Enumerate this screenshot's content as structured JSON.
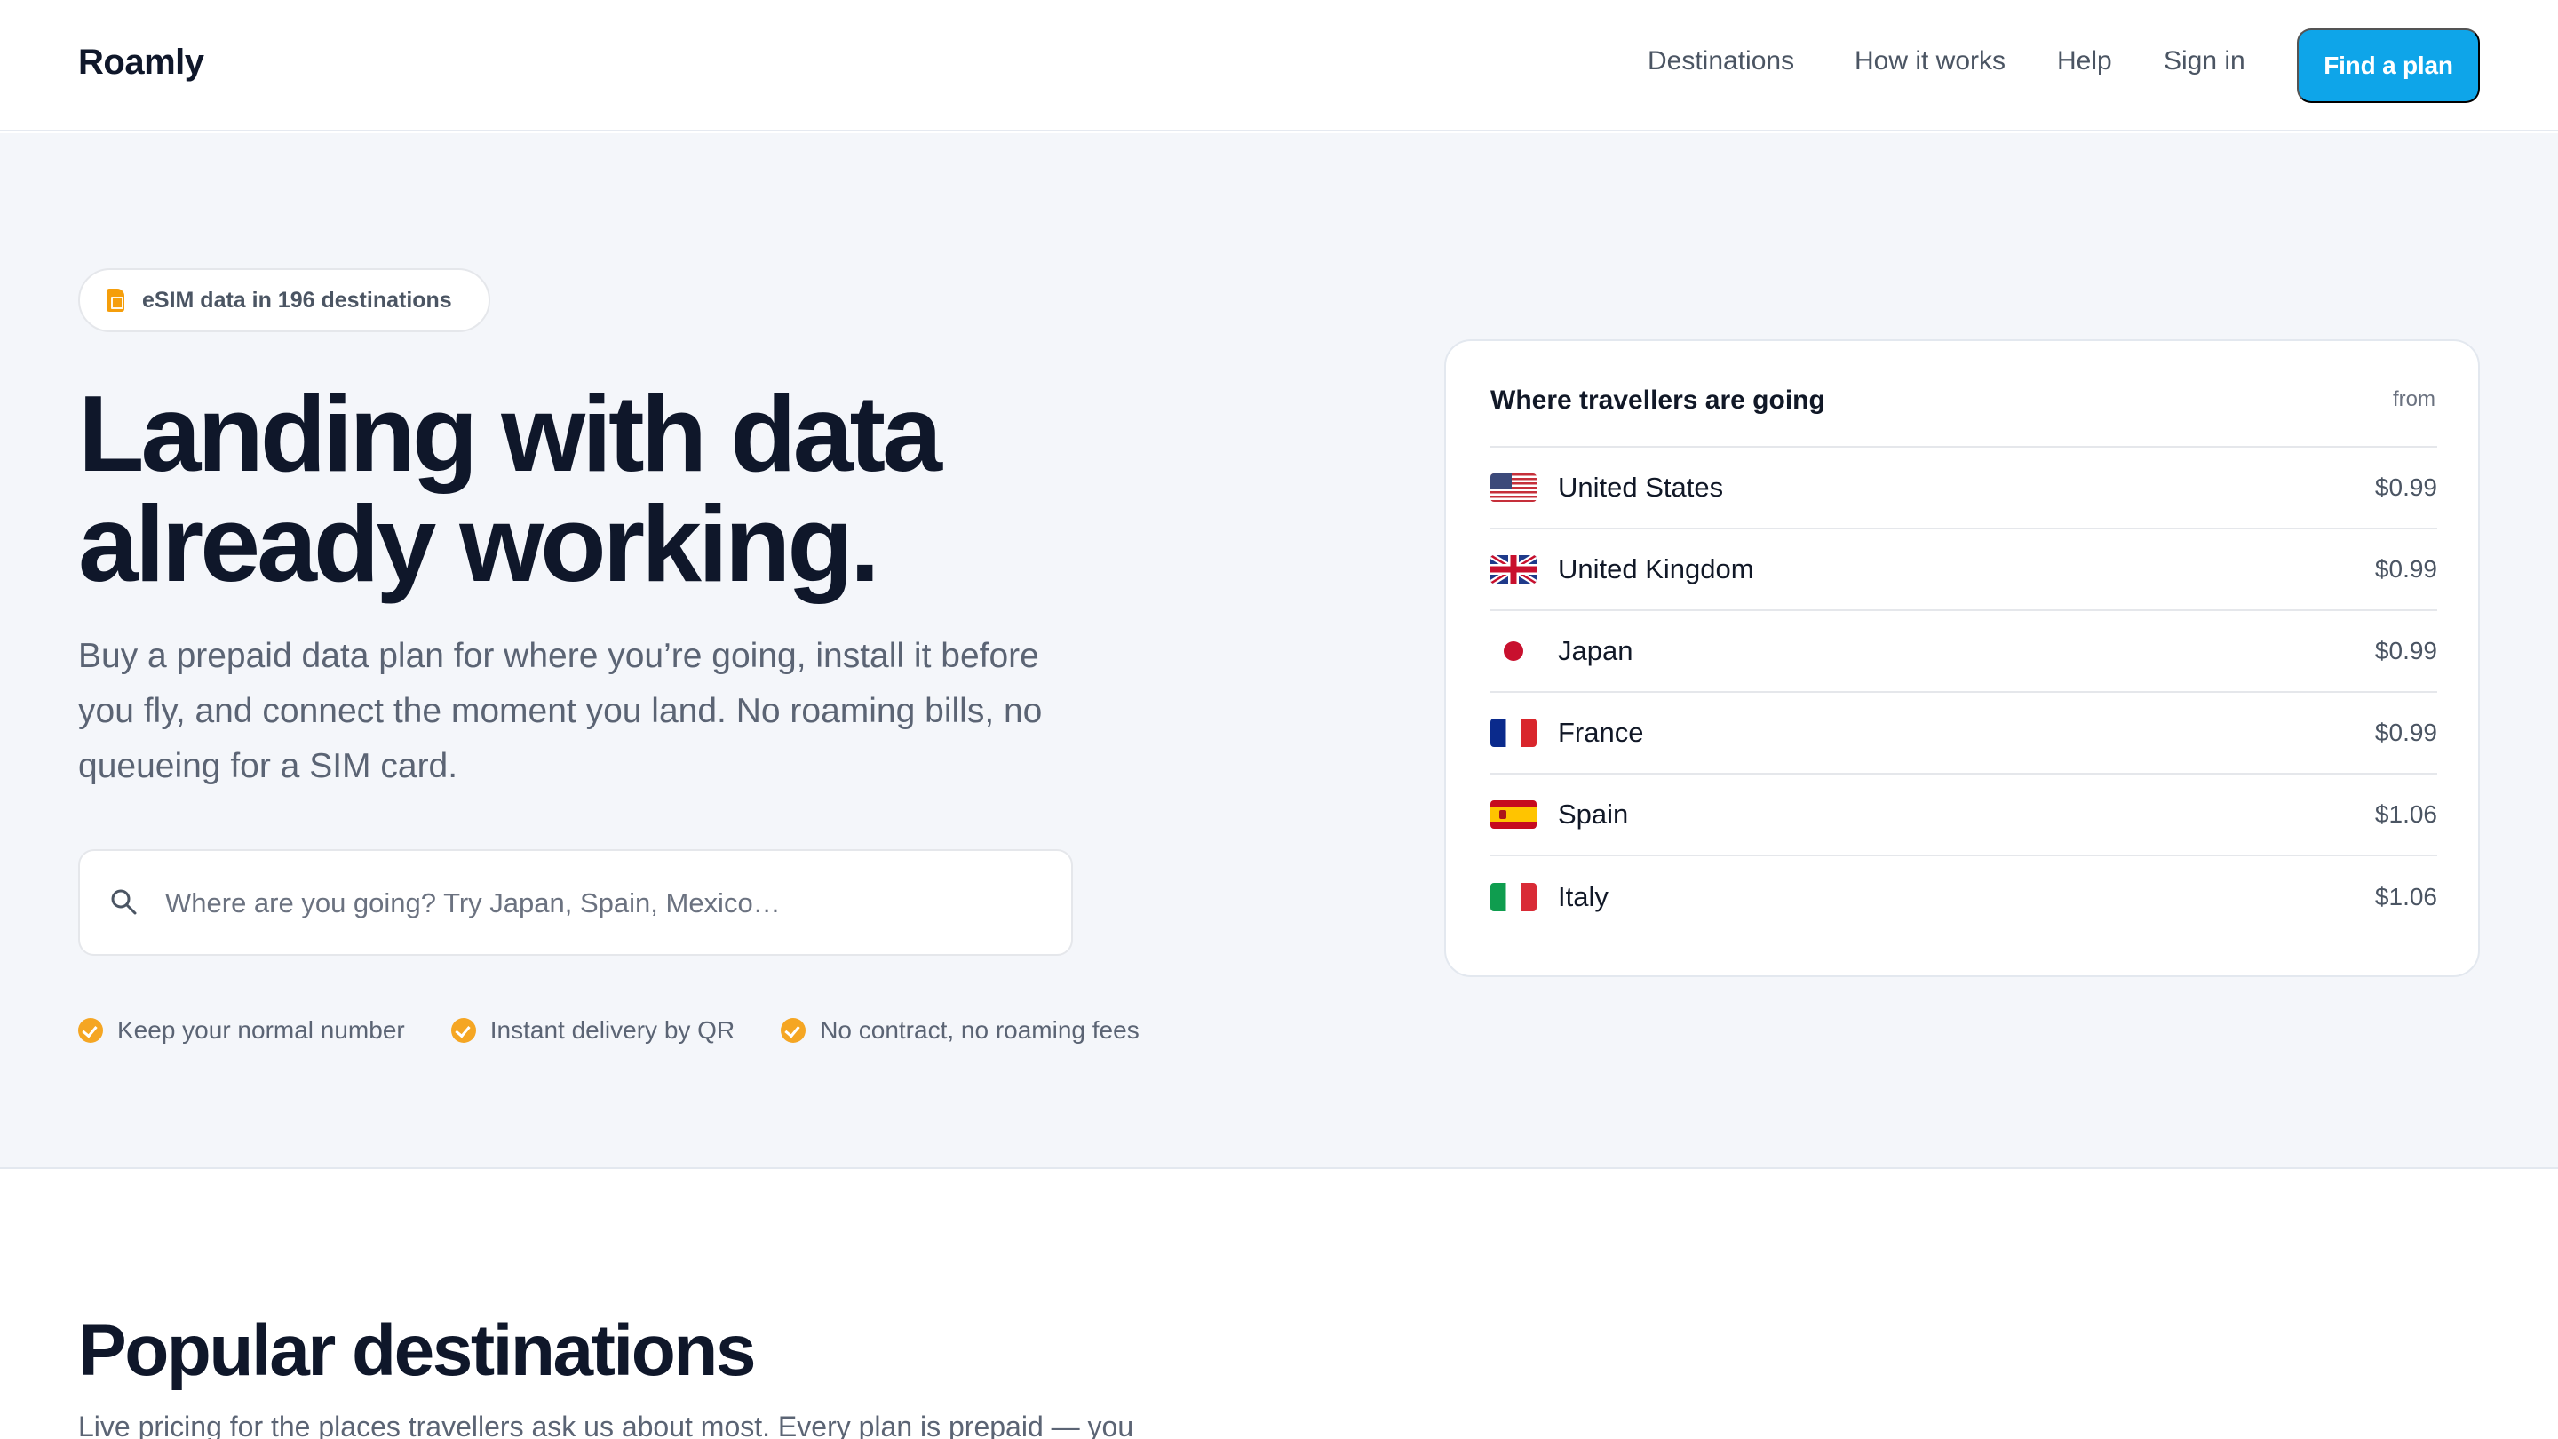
{
  "nav": {
    "logo": "Roamly",
    "links": [
      "Destinations",
      "How it works",
      "Help",
      "Sign in"
    ],
    "cta": "Find a plan"
  },
  "hero": {
    "badge": "eSIM data in 196 destinations",
    "headline_line1": "Landing with data",
    "headline_line2": "already working.",
    "subcopy": "Buy a prepaid data plan for where you’re going, install it before you fly, and connect the moment you land. No roaming bills, no queueing for a SIM card.",
    "search_placeholder": "Where are you going? Try Japan, Spain, Mexico…",
    "search_value": "",
    "perks": [
      "Keep your normal number",
      "Instant delivery by QR",
      "No contract, no roaming fees"
    ]
  },
  "card": {
    "title": "Where travellers are going",
    "from_label": "from",
    "rows": [
      {
        "flag": "us-flag-icon",
        "country": "United States",
        "price": "$0.99"
      },
      {
        "flag": "uk-flag-icon",
        "country": "United Kingdom",
        "price": "$0.99"
      },
      {
        "flag": "japan-flag-icon",
        "country": "Japan",
        "price": "$0.99"
      },
      {
        "flag": "france-flag-icon",
        "country": "France",
        "price": "$0.99"
      },
      {
        "flag": "spain-flag-icon",
        "country": "Spain",
        "price": "$1.06"
      },
      {
        "flag": "italy-flag-icon",
        "country": "Italy",
        "price": "$1.06"
      }
    ]
  },
  "popular": {
    "title": "Popular destinations",
    "subtitle": "Live pricing for the places travellers ask us about most. Every plan is prepaid — you"
  },
  "colors": {
    "accent": "#0ea5e9",
    "check": "#f5a623",
    "hero_bg": "#f4f6fa",
    "ink": "#0f172a"
  }
}
